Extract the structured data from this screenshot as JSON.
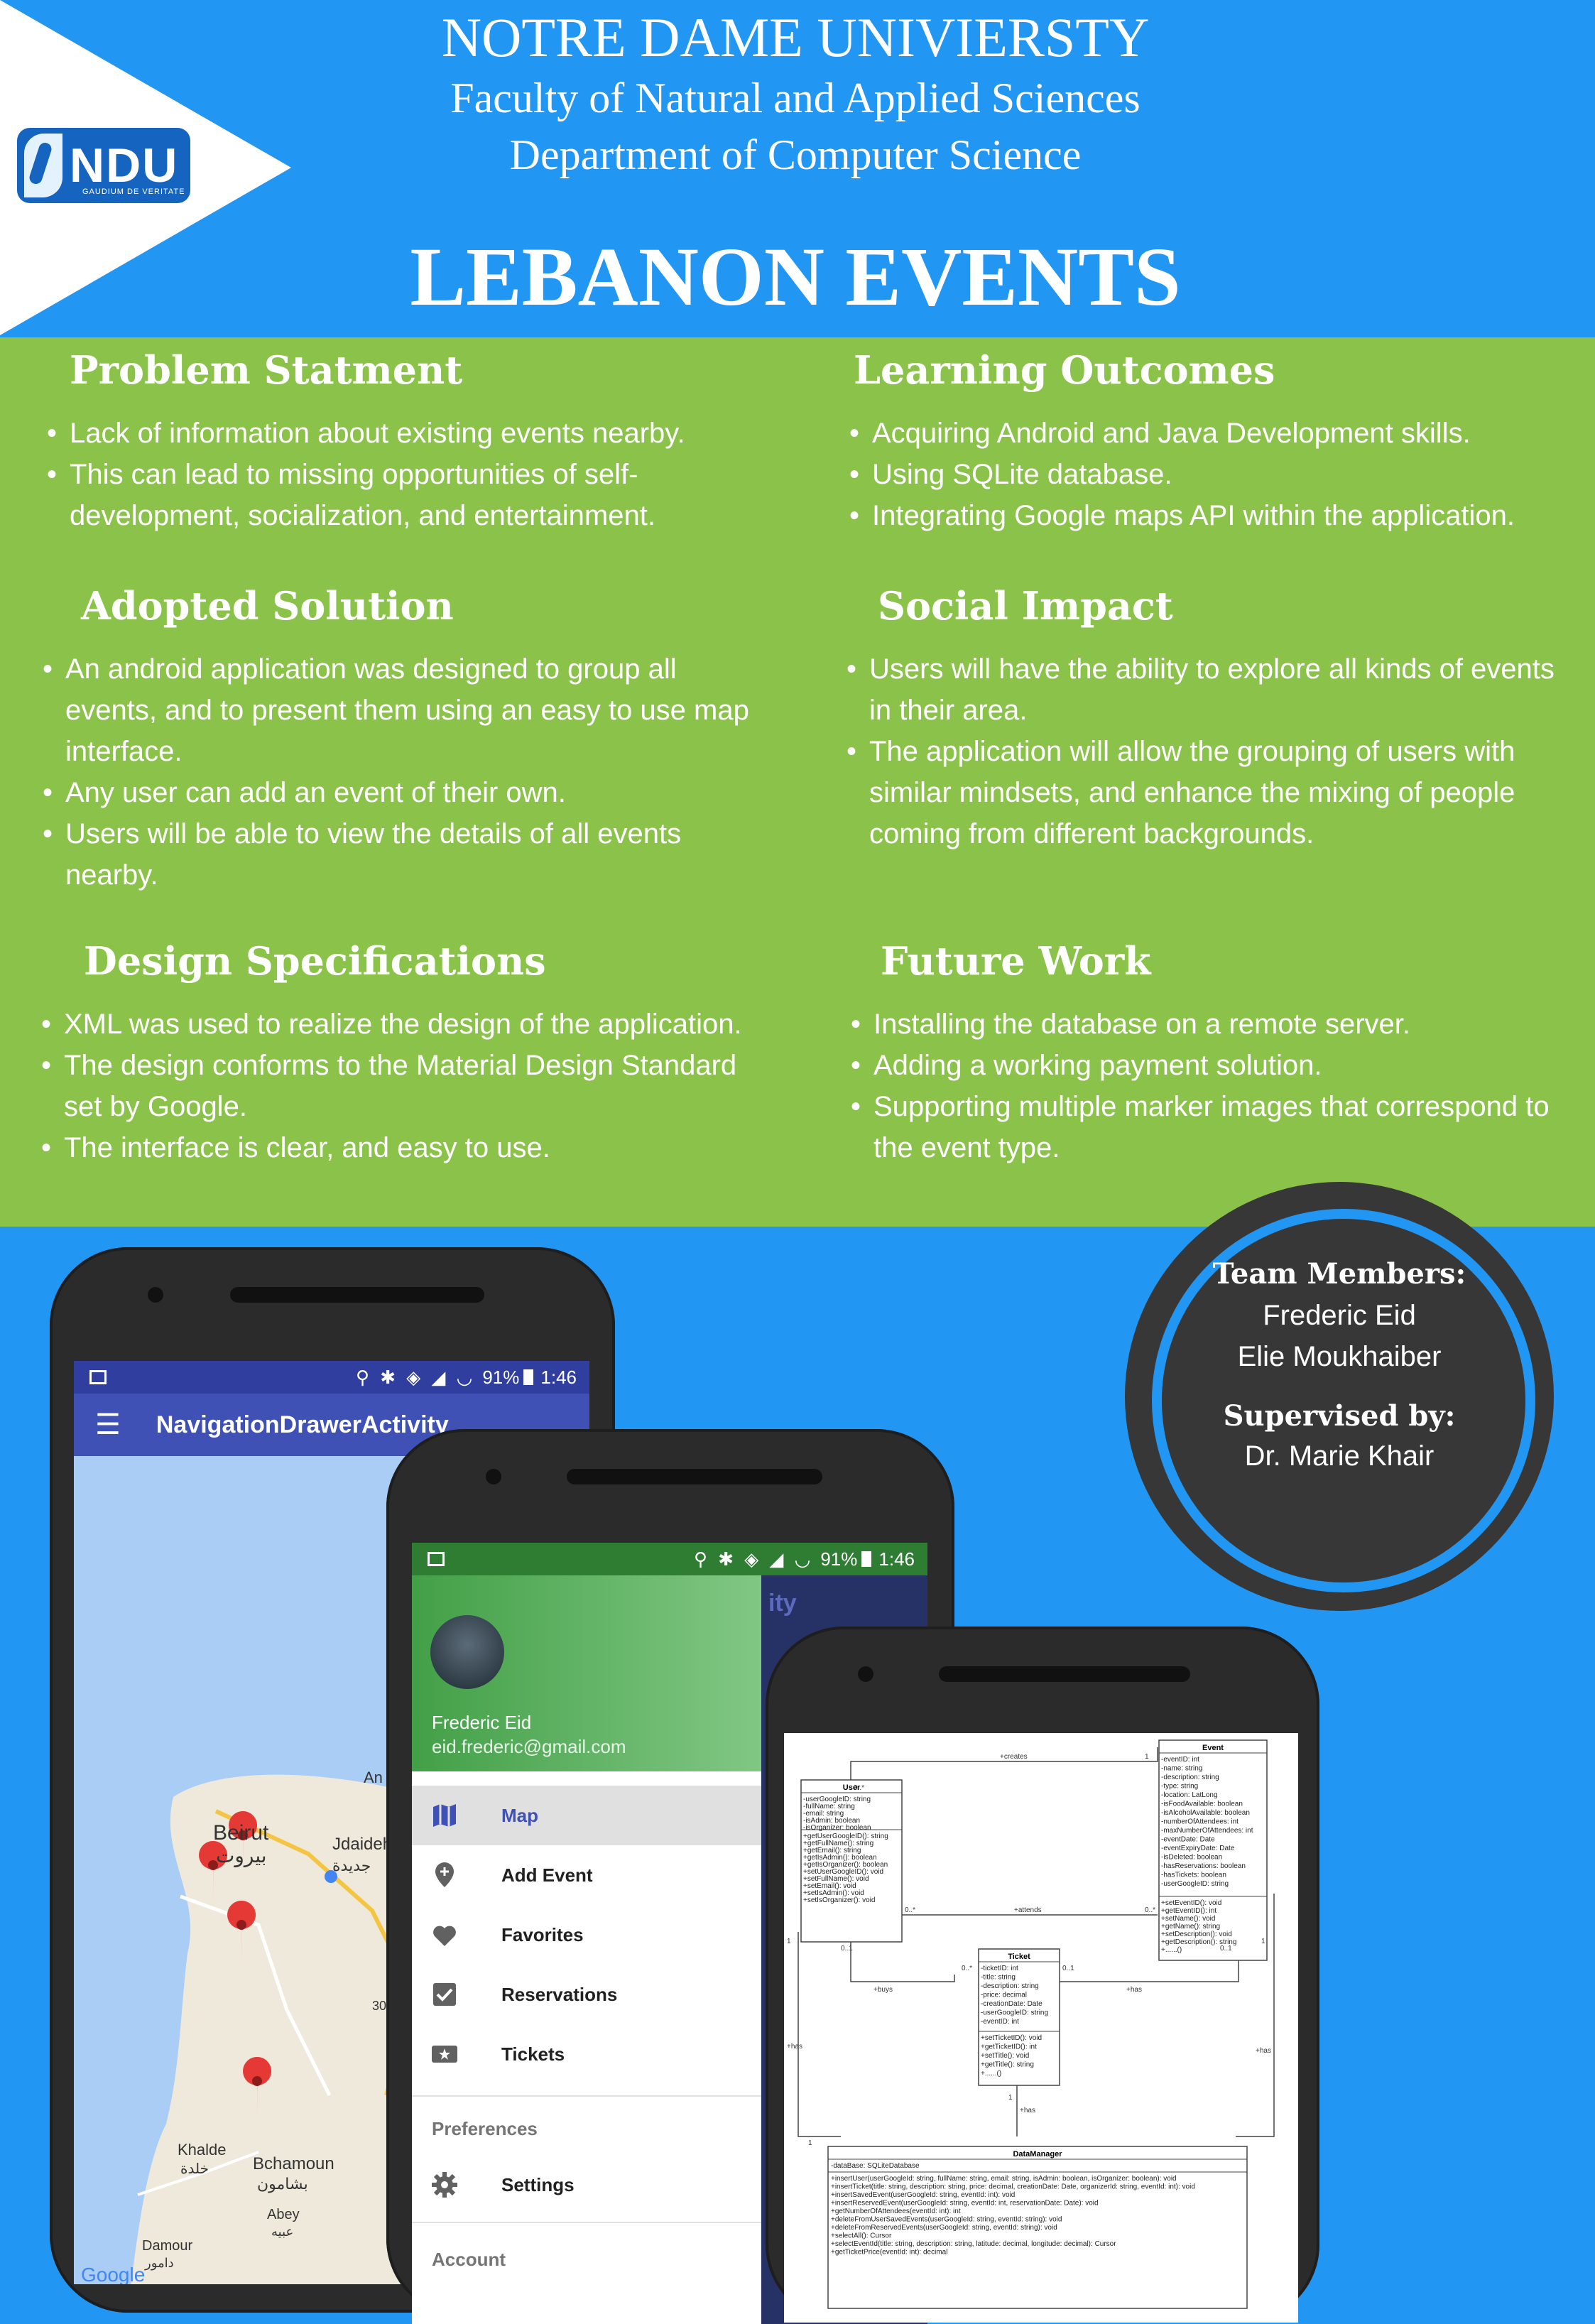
{
  "header": {
    "university": "NOTRE DAME UNIVIERSTY",
    "faculty": "Faculty of Natural and Applied Sciences",
    "department": "Department of Computer Science",
    "title": "LEBANON EVENTS",
    "logo_text": "NDU",
    "logo_subtext": "GAUDIUM DE VERITATE"
  },
  "sections": {
    "problem": {
      "heading": "Problem Statment",
      "items": [
        "Lack of information about existing events nearby.",
        "This can lead to missing opportunities of self-development, socialization, and entertainment."
      ]
    },
    "learning": {
      "heading": "Learning Outcomes",
      "items": [
        "Acquiring Android and Java Development skills.",
        "Using SQLite database.",
        "Integrating Google maps API within the application."
      ]
    },
    "solution": {
      "heading": "Adopted Solution",
      "items": [
        "An android application was designed to group all events, and to present them using an easy to use map interface.",
        "Any user can add an event of their own.",
        "Users will be able to view the details of all events nearby."
      ]
    },
    "impact": {
      "heading": "Social Impact",
      "items": [
        "Users will have the ability to explore all kinds of events in their area.",
        "The application will allow the grouping of users with similar mindsets, and enhance the mixing of people coming from different backgrounds."
      ]
    },
    "design": {
      "heading": "Design Specifications",
      "items": [
        "XML was used to realize the design of the application.",
        "The design conforms to the Material Design Standard set by Google.",
        "The interface is clear, and easy to use."
      ]
    },
    "future": {
      "heading": "Future Work",
      "items": [
        "Installing the database on a remote server.",
        "Adding a working payment solution.",
        "Supporting multiple marker images that correspond to the event type."
      ]
    }
  },
  "team": {
    "members_heading": "Team Members:",
    "members": [
      "Frederic Eid",
      "Elie Moukhaiber"
    ],
    "supervisor_heading": "Supervised by:",
    "supervisor": "Dr. Marie Khair"
  },
  "phone1": {
    "status_battery": "91%",
    "status_time": "1:46",
    "app_title": "NavigationDrawerActivity",
    "map_labels": [
      "Beirut",
      "بيروت",
      "Jdaideh",
      "جديدة",
      "Khalde",
      "خلدة",
      "Bchamoun",
      "بشامون",
      "Damour",
      "دامور",
      "Abey",
      "عبيه",
      "An",
      "30"
    ],
    "google_label": "Google"
  },
  "phone2": {
    "status_battery": "91%",
    "status_time": "1:46",
    "user_name": "Frederic Eid",
    "user_email": "eid.frederic@gmail.com",
    "behind_title": "ity",
    "menu": [
      {
        "label": "Map",
        "icon": "map-icon",
        "active": true
      },
      {
        "label": "Add Event",
        "icon": "add-location-icon",
        "active": false
      },
      {
        "label": "Favorites",
        "icon": "heart-icon",
        "active": false
      },
      {
        "label": "Reservations",
        "icon": "check-box-icon",
        "active": false
      },
      {
        "label": "Tickets",
        "icon": "ticket-icon",
        "active": false
      }
    ],
    "preferences_label": "Preferences",
    "settings_label": "Settings",
    "account_label": "Account"
  },
  "uml": {
    "user": {
      "name": "User",
      "attrs": [
        "-userGoogleID: string",
        "-fullName: string",
        "-email: string",
        "-isAdmin: boolean",
        "-isOrganizer: boolean"
      ],
      "methods": [
        "+getUserGoogleID(): string",
        "+getFullName(): string",
        "+getEmail(): string",
        "+getIsAdmin(): boolean",
        "+getIsOrganizer(): boolean",
        "+setUserGoogleID(): void",
        "+setFullName(): void",
        "+setEmail(): void",
        "+setIsAdmin(): void",
        "+setIsOrganizer(): void"
      ]
    },
    "event": {
      "name": "Event",
      "attrs": [
        "-eventID: int",
        "-name: string",
        "-description: string",
        "-type: string",
        "-location: LatLong",
        "-isFoodAvailable: boolean",
        "-isAlcoholAvailable: boolean",
        "-numberOfAttendees: int",
        "-maxNumberOfAttendees: int",
        "-eventDate: Date",
        "-eventExpiryDate: Date",
        "-isDeleted: boolean",
        "-hasReservations: boolean",
        "-hasTickets: boolean",
        "-userGoogleID: string"
      ],
      "methods": [
        "+setEventID(): void",
        "+getEventID(): int",
        "+setName(): void",
        "+getName(): string",
        "+setDescription(): void",
        "+getDescription(): string",
        "+......()"
      ]
    },
    "ticket": {
      "name": "Ticket",
      "attrs": [
        "-ticketID: int",
        "-title: string",
        "-description: string",
        "-price: decimal",
        "-creationDate: Date",
        "-userGoogleID: string",
        "-eventID: int"
      ],
      "methods": [
        "+setTicketID(): void",
        "+getTicketID(): int",
        "+setTitle(): void",
        "+getTitle(): string",
        "+......()"
      ]
    },
    "manager": {
      "name": "DataManager",
      "attrs": [
        "-dataBase: SQLiteDatabase"
      ],
      "methods": [
        "+insertUser(userGoogleId: string, fullName: string, email: string, isAdmin: boolean, isOrganizer: boolean): void",
        "+insertTicket(title: string, description: string, price: decimal, creationDate: Date, organizerId: string, eventId: int): void",
        "+insertSavedEvent(userGoogleId: string, eventId: int): void",
        "+insertReservedEvent(userGoogleId: string, eventId: int, reservationDate: Date): void",
        "+getNumberOfAttendees(eventId: int): int",
        "+deleteFromUserSavedEvents(userGoogleId: string, eventId: string): void",
        "+deleteFromReservedEvents(userGoogleId: string, eventId: string): void",
        "+selectAll(): Cursor",
        "+selectEventId(title: string, description: string, latitude: decimal, longitude: decimal): Cursor",
        "+getTicketPrice(eventId: int): decimal"
      ]
    },
    "labels": {
      "creates": "+creates",
      "attends": "+attends",
      "buys": "+buys",
      "has": "+has",
      "m_0star": "0..*",
      "m_1": "1",
      "m_01": "0..1"
    }
  },
  "colors": {
    "header_blue": "#2196F3",
    "section_green": "#8BC34A",
    "phone_body": "#2b2b2b",
    "circle_dark": "#373737",
    "app_bar_indigo": "#3F51B5",
    "drawer_green": "#43A047",
    "active_item_blue": "#3F51B5"
  }
}
